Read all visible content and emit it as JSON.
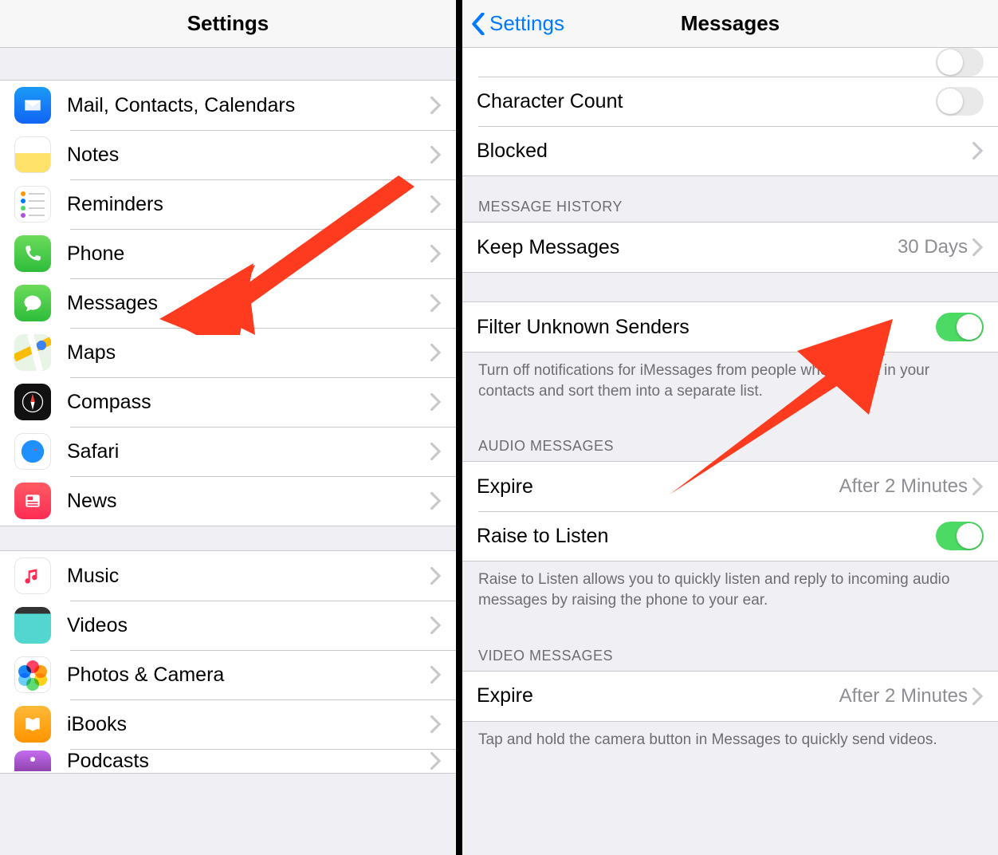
{
  "left": {
    "title": "Settings",
    "groups": [
      {
        "items": [
          {
            "id": "mail",
            "label": "Mail, Contacts, Calendars",
            "icon": "mail"
          },
          {
            "id": "notes",
            "label": "Notes",
            "icon": "notes"
          },
          {
            "id": "reminders",
            "label": "Reminders",
            "icon": "reminders"
          },
          {
            "id": "phone",
            "label": "Phone",
            "icon": "phone"
          },
          {
            "id": "messages",
            "label": "Messages",
            "icon": "messages"
          },
          {
            "id": "maps",
            "label": "Maps",
            "icon": "maps"
          },
          {
            "id": "compass",
            "label": "Compass",
            "icon": "compass"
          },
          {
            "id": "safari",
            "label": "Safari",
            "icon": "safari"
          },
          {
            "id": "news",
            "label": "News",
            "icon": "news"
          }
        ]
      },
      {
        "items": [
          {
            "id": "music",
            "label": "Music",
            "icon": "music"
          },
          {
            "id": "videos",
            "label": "Videos",
            "icon": "videos"
          },
          {
            "id": "photos",
            "label": "Photos & Camera",
            "icon": "photos"
          },
          {
            "id": "ibooks",
            "label": "iBooks",
            "icon": "ibooks"
          },
          {
            "id": "podcasts",
            "label": "Podcasts",
            "icon": "podcasts"
          }
        ]
      }
    ]
  },
  "right": {
    "back_label": "Settings",
    "title": "Messages",
    "top_rows": {
      "char_count": {
        "label": "Character Count",
        "on": false
      },
      "blocked": {
        "label": "Blocked"
      }
    },
    "history": {
      "header": "Message History",
      "keep_label": "Keep Messages",
      "keep_value": "30 Days"
    },
    "filter": {
      "label": "Filter Unknown Senders",
      "on": true,
      "footer": "Turn off notifications for iMessages from people who are not in your contacts and sort them into a separate list."
    },
    "audio": {
      "header": "Audio Messages",
      "expire_label": "Expire",
      "expire_value": "After 2 Minutes",
      "raise_label": "Raise to Listen",
      "raise_on": true,
      "footer": "Raise to Listen allows you to quickly listen and reply to incoming audio messages by raising the phone to your ear."
    },
    "video": {
      "header": "Video Messages",
      "expire_label": "Expire",
      "expire_value": "After 2 Minutes",
      "footer": "Tap and hold the camera button in Messages to quickly send videos."
    }
  },
  "colors": {
    "ios_blue": "#007aff",
    "ios_green": "#4cd964",
    "arrow": "#ff3b1f"
  }
}
